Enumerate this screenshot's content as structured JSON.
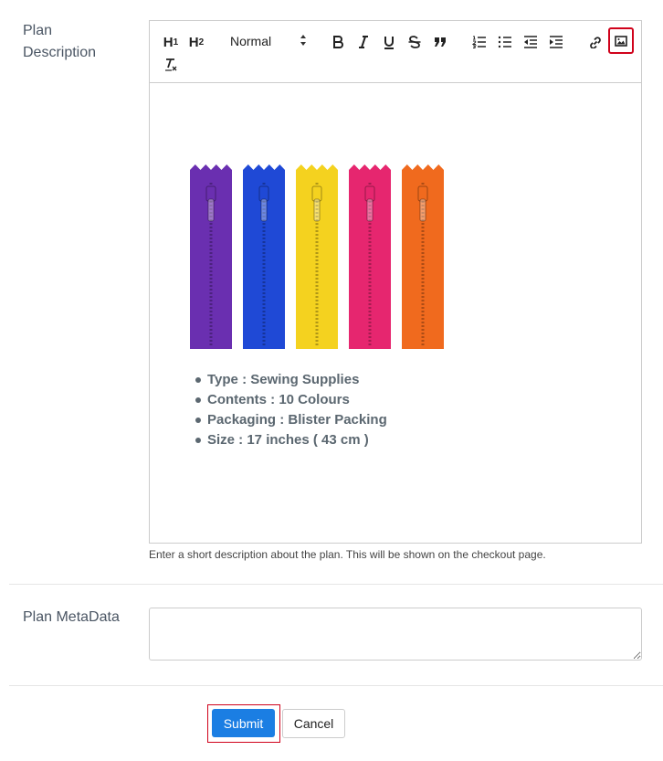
{
  "form": {
    "plan_description_label": "Plan Description",
    "plan_metadata_label": "Plan MetaData",
    "metadata_value": "",
    "help_text": "Enter a short description about the plan. This will be shown on the checkout page."
  },
  "toolbar": {
    "h1_label": "H",
    "h1_sub": "1",
    "h2_label": "H",
    "h2_sub": "2",
    "format_select": "Normal",
    "bold_icon": "bold-icon",
    "italic_icon": "italic-icon",
    "underline_icon": "underline-icon",
    "strike_icon": "strikethrough-icon",
    "quote_icon": "blockquote-icon",
    "ordered_list_icon": "ordered-list-icon",
    "bullet_list_icon": "bullet-list-icon",
    "outdent_icon": "outdent-icon",
    "indent_icon": "indent-icon",
    "link_icon": "link-icon",
    "image_icon": "image-icon",
    "clean_icon": "clear-format-icon"
  },
  "content": {
    "image": "product-image-zippers",
    "zipper_colors": [
      "#6a2fb0",
      "#1f49d6",
      "#f4d21f",
      "#e6266f",
      "#f06a1e"
    ],
    "bullets": [
      "Type : Sewing Supplies",
      "Contents : 10 Colours",
      "Packaging : Blister Packing",
      "Size : 17 inches ( 43 cm )"
    ]
  },
  "buttons": {
    "submit": "Submit",
    "cancel": "Cancel"
  },
  "colors": {
    "accent": "#1b7ee3",
    "highlight": "#d0021b",
    "border": "#cccccc"
  }
}
